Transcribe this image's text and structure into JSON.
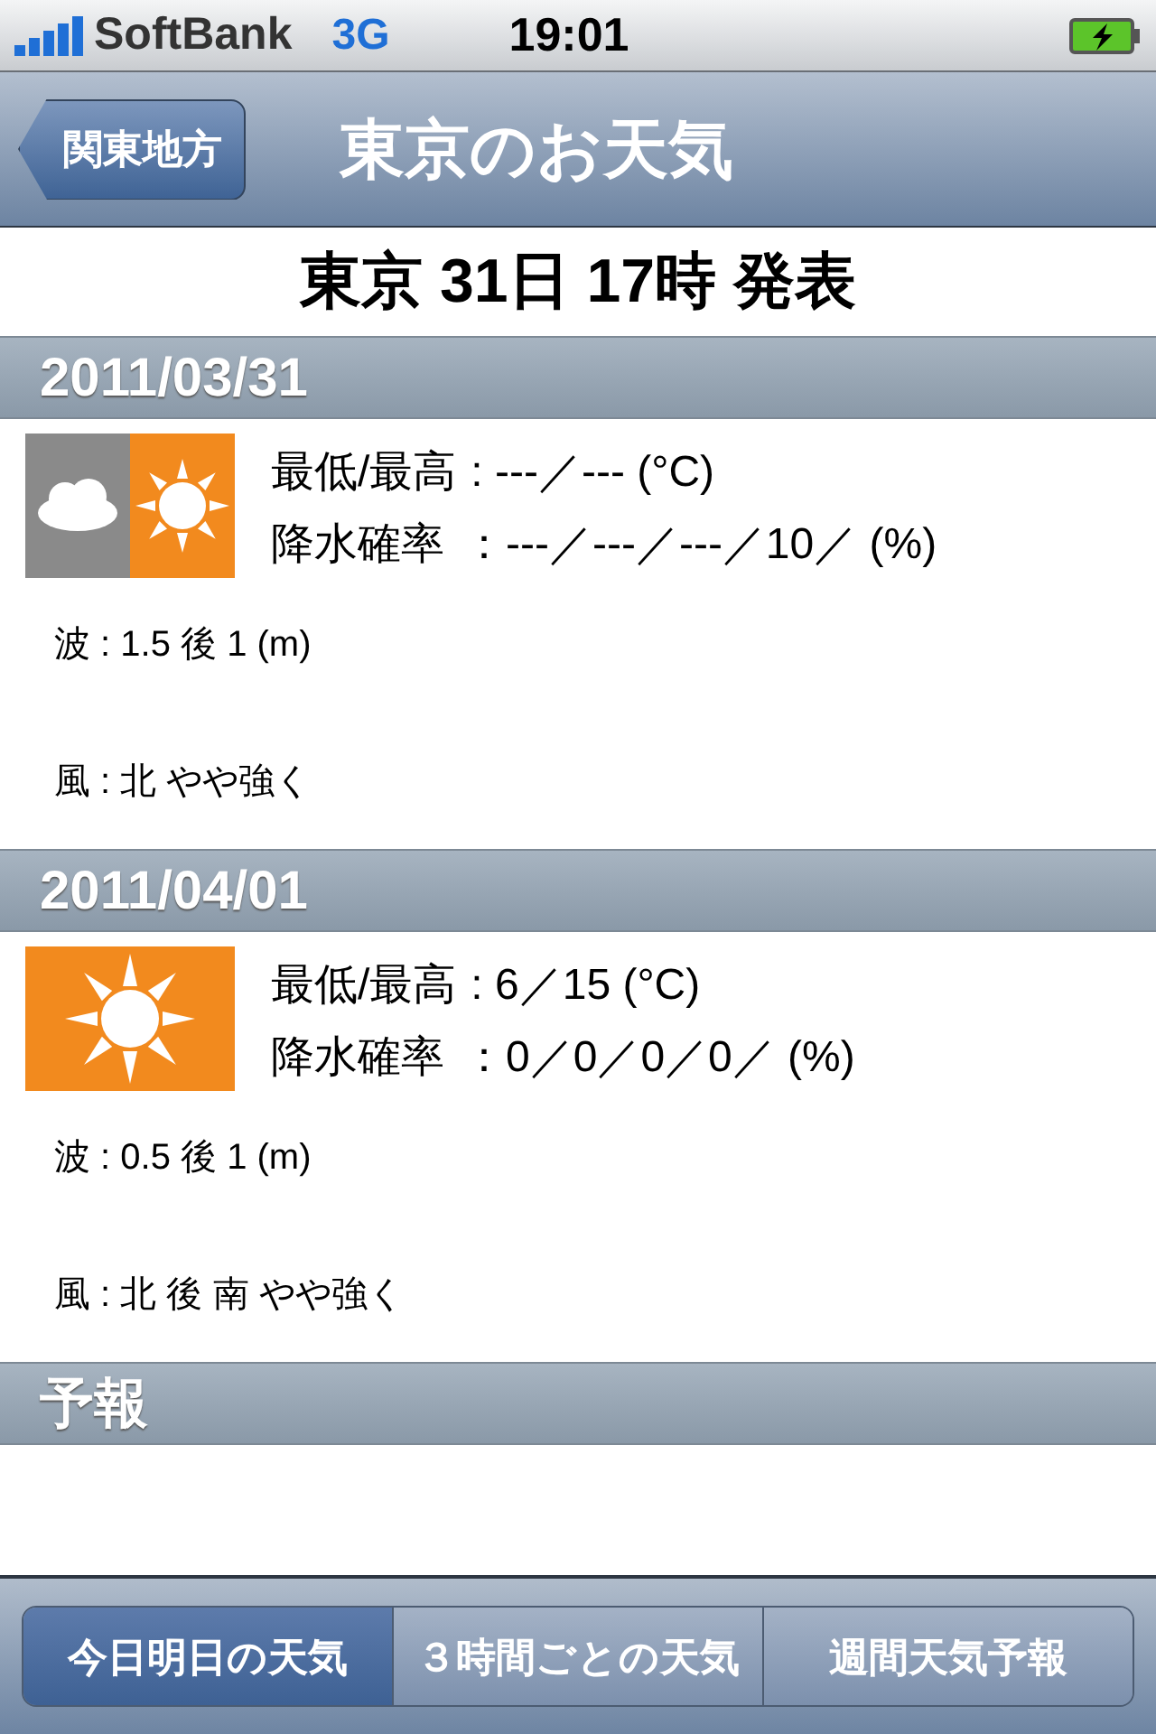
{
  "status_bar": {
    "carrier": "SoftBank",
    "network": "3G",
    "time": "19:01"
  },
  "nav_bar": {
    "back": "関東地方",
    "title": "東京のお天気"
  },
  "headline": "東京 31日 17時 発表",
  "days": [
    {
      "date": "2011/03/31",
      "kind": "cloudy_then_sunny",
      "temp_label": "最低/最高",
      "temp": ": ---／--- (°C)",
      "rain_label": "降水確率",
      "rain": "：---／---／---／10／ (%)",
      "wave": "波 : 1.5 後 1  (m)",
      "wind": "風 : 北 やや強く"
    },
    {
      "date": "2011/04/01",
      "kind": "sunny",
      "temp_label": "最低/最高",
      "temp": ": 6／15 (°C)",
      "rain_label": "降水確率",
      "rain": "：0／0／0／0／ (%)",
      "wave": "波 : 0.5 後 1  (m)",
      "wind": "風 : 北 後 南 やや強く"
    }
  ],
  "forecast": {
    "title": "予報"
  },
  "tabs": [
    {
      "label": "今日明日の天気",
      "selected": true
    },
    {
      "label": "３時間ごとの天気",
      "selected": false
    },
    {
      "label": "週間天気予報",
      "selected": false
    }
  ]
}
